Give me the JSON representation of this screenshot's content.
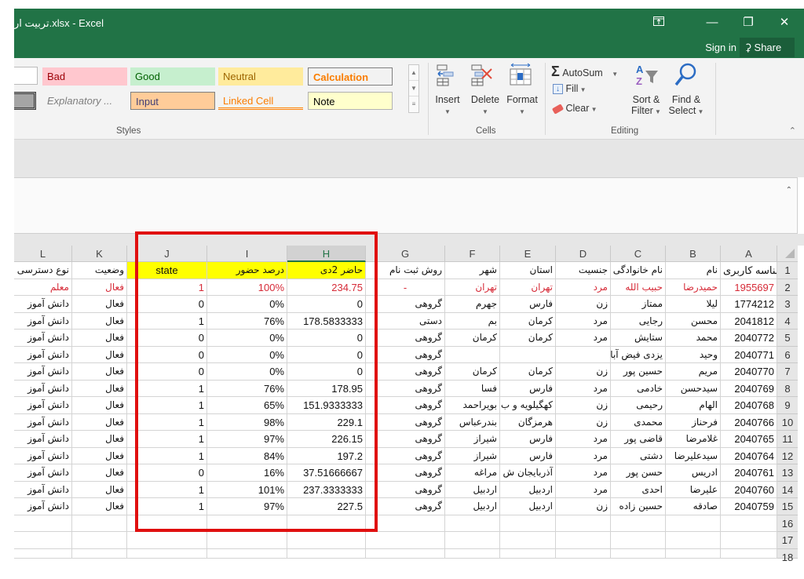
{
  "window": {
    "title": "تربیت ار.xlsx - Excel",
    "sign_in": "Sign in",
    "share": "Share",
    "icons": {
      "ribbon_display": "ribbon-display-options-icon",
      "minimize": "minimize-icon",
      "restore": "restore-icon",
      "close": "close-icon",
      "share": "person-add-icon"
    }
  },
  "ribbon": {
    "styles": {
      "label": "Styles",
      "row1": [
        {
          "label": "",
          "name": "normal"
        },
        {
          "label": "Bad",
          "name": "bad"
        },
        {
          "label": "Good",
          "name": "good"
        },
        {
          "label": "Neutral",
          "name": "neutral"
        },
        {
          "label": "Calculation",
          "name": "calculation"
        }
      ],
      "row2": [
        {
          "label": "",
          "name": "check-cell"
        },
        {
          "label": "Explanatory ...",
          "name": "explanatory"
        },
        {
          "label": "Input",
          "name": "input"
        },
        {
          "label": "Linked Cell",
          "name": "linked-cell"
        },
        {
          "label": "Note",
          "name": "note"
        }
      ]
    },
    "cells": {
      "label": "Cells",
      "insert": "Insert",
      "delete": "Delete",
      "format": "Format"
    },
    "editing": {
      "label": "Editing",
      "autosum": "AutoSum",
      "fill": "Fill",
      "clear": "Clear",
      "sort_filter_1": "Sort &",
      "sort_filter_2": "Filter",
      "find_select_1": "Find &",
      "find_select_2": "Select"
    }
  },
  "sheet": {
    "columns": [
      "L",
      "K",
      "J",
      "I",
      "H",
      "G",
      "F",
      "E",
      "D",
      "C",
      "B",
      "A"
    ],
    "selected_column": "H",
    "row_numbers": [
      "1",
      "2",
      "3",
      "4",
      "5",
      "6",
      "7",
      "8",
      "9",
      "10",
      "11",
      "12",
      "13",
      "14",
      "15",
      "16",
      "17",
      "18"
    ],
    "header_row": {
      "L": "نوع دسترسی",
      "K": "وضعیت",
      "J": "state",
      "I": "درصد حضور",
      "H": "حاضر 2دی",
      "G": "روش ثبت نام",
      "F": "شهر",
      "E": "استان",
      "D": "جنسیت",
      "C": "نام خانوادگی",
      "B": "نام",
      "A": "شناسه کاربری"
    },
    "rows": [
      {
        "L": "معلم",
        "K": "فعال",
        "J": "1",
        "I": "100%",
        "H": "234.75",
        "G": "-",
        "F": "تهران",
        "E": "تهران",
        "D": "مرد",
        "C": "حبیب الله",
        "B": "حمیدرضا",
        "A": "1955697",
        "red": true
      },
      {
        "L": "دانش آموز",
        "K": "فعال",
        "J": "0",
        "I": "0%",
        "H": "0",
        "G": "گروهی",
        "F": "جهرم",
        "E": "فارس",
        "D": "زن",
        "C": "ممتاز",
        "B": "لیلا",
        "A": "1774212"
      },
      {
        "L": "دانش آموز",
        "K": "فعال",
        "J": "1",
        "I": "76%",
        "H": "178.5833333",
        "G": "دستی",
        "F": "بم",
        "E": "کرمان",
        "D": "مرد",
        "C": "رجایی",
        "B": "محسن",
        "A": "2041812"
      },
      {
        "L": "دانش آموز",
        "K": "فعال",
        "J": "0",
        "I": "0%",
        "H": "0",
        "G": "گروهی",
        "F": "کرمان",
        "E": "کرمان",
        "D": "مرد",
        "C": "ستایش",
        "B": "محمد",
        "A": "2040772"
      },
      {
        "L": "دانش آموز",
        "K": "فعال",
        "J": "0",
        "I": "0%",
        "H": "0",
        "G": "گروهی",
        "F": "",
        "E": "",
        "D": "",
        "C": "یزدی فیض آبادی",
        "B": "وحید",
        "A": "2040771"
      },
      {
        "L": "دانش آموز",
        "K": "فعال",
        "J": "0",
        "I": "0%",
        "H": "0",
        "G": "گروهی",
        "F": "کرمان",
        "E": "کرمان",
        "D": "زن",
        "C": "حسین پور",
        "B": "مریم",
        "A": "2040770"
      },
      {
        "L": "دانش آموز",
        "K": "فعال",
        "J": "1",
        "I": "76%",
        "H": "178.95",
        "G": "گروهی",
        "F": "فسا",
        "E": "فارس",
        "D": "مرد",
        "C": "خادمی",
        "B": "سیدحسن",
        "A": "2040769"
      },
      {
        "L": "دانش آموز",
        "K": "فعال",
        "J": "1",
        "I": "65%",
        "H": "151.9333333",
        "G": "گروهی",
        "F": "بویراحمد",
        "E": "کهگیلویه و ب",
        "D": "زن",
        "C": "رحیمی",
        "B": "الهام",
        "A": "2040768"
      },
      {
        "L": "دانش آموز",
        "K": "فعال",
        "J": "1",
        "I": "98%",
        "H": "229.1",
        "G": "گروهی",
        "F": "بندرعباس",
        "E": "هرمزگان",
        "D": "زن",
        "C": "محمدی",
        "B": "فرحناز",
        "A": "2040766"
      },
      {
        "L": "دانش آموز",
        "K": "فعال",
        "J": "1",
        "I": "97%",
        "H": "226.15",
        "G": "گروهی",
        "F": "شیراز",
        "E": "فارس",
        "D": "مرد",
        "C": "قاضی پور",
        "B": "غلامرضا",
        "A": "2040765"
      },
      {
        "L": "دانش آموز",
        "K": "فعال",
        "J": "1",
        "I": "84%",
        "H": "197.2",
        "G": "گروهی",
        "F": "شیراز",
        "E": "فارس",
        "D": "مرد",
        "C": "دشتی",
        "B": "سیدعلیرضا",
        "A": "2040764"
      },
      {
        "L": "دانش آموز",
        "K": "فعال",
        "J": "0",
        "I": "16%",
        "H": "37.51666667",
        "G": "گروهی",
        "F": "مراغه",
        "E": "آذربایجان ش",
        "D": "مرد",
        "C": "حسن پور",
        "B": "ادریس",
        "A": "2040761"
      },
      {
        "L": "دانش آموز",
        "K": "فعال",
        "J": "1",
        "I": "101%",
        "H": "237.3333333",
        "G": "گروهی",
        "F": "اردبیل",
        "E": "اردبیل",
        "D": "مرد",
        "C": "احدی",
        "B": "علیرضا",
        "A": "2040760"
      },
      {
        "L": "دانش آموز",
        "K": "فعال",
        "J": "1",
        "I": "97%",
        "H": "227.5",
        "G": "گروهی",
        "F": "اردبیل",
        "E": "اردبیل",
        "D": "زن",
        "C": "حسین زاده",
        "B": "صادقه",
        "A": "2040759"
      }
    ],
    "annotation": "red-highlight-box-around-columns-H-I-J"
  },
  "colors": {
    "excel_green": "#217346",
    "highlight_red": "#e01010",
    "header_yellow": "#ffff00",
    "red_text": "#d62b38"
  }
}
